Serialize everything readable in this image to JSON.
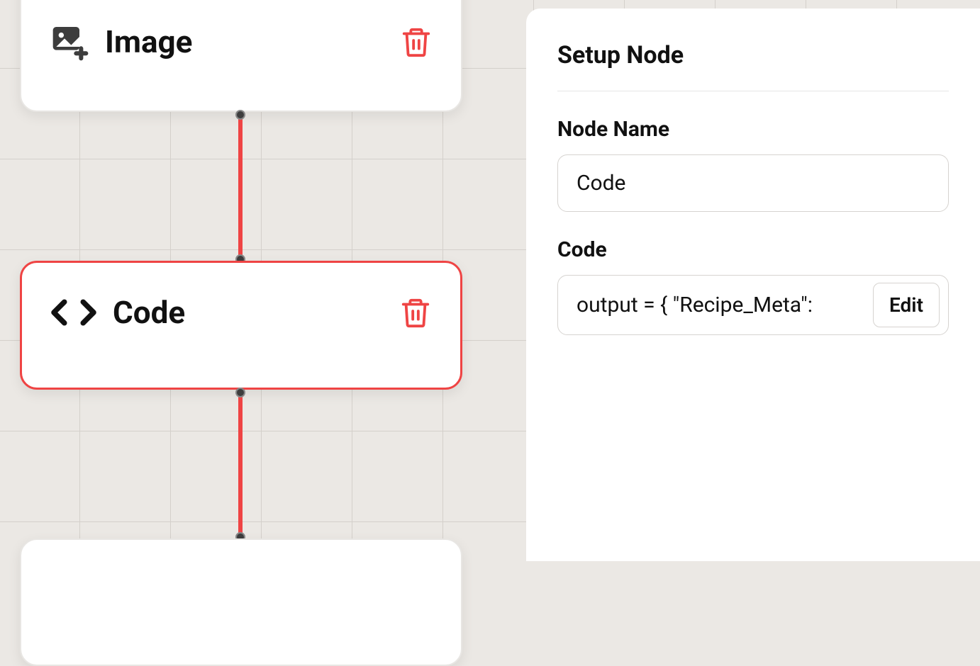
{
  "canvas": {
    "nodes": {
      "image": {
        "title": "Image"
      },
      "code": {
        "title": "Code"
      }
    }
  },
  "panel": {
    "title": "Setup Node",
    "fields": {
      "name": {
        "label": "Node Name",
        "value": "Code"
      },
      "code": {
        "label": "Code",
        "preview": "output = {         \"Recipe_Meta\":",
        "edit_label": "Edit"
      }
    }
  }
}
